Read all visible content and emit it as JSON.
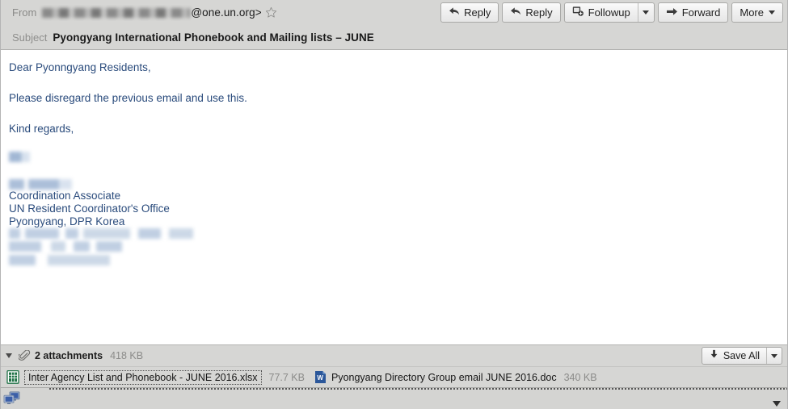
{
  "header": {
    "from_label": "From",
    "from_redacted": true,
    "from_address": "@one.un.org>",
    "star_icon": "star-outline-icon",
    "subject_label": "Subject",
    "subject": "Pyongyang International Phonebook and Mailing lists – JUNE"
  },
  "toolbar": {
    "buttons": [
      {
        "label": "Reply",
        "icon": "reply-arrow-icon",
        "has_dropdown": false
      },
      {
        "label": "Reply",
        "icon": "reply-arrow-icon",
        "has_dropdown": false
      },
      {
        "label": "Followup",
        "icon": "followup-flag-icon",
        "has_dropdown": true
      },
      {
        "label": "Forward",
        "icon": "forward-arrow-icon",
        "has_dropdown": false
      },
      {
        "label": "More",
        "icon": "",
        "has_dropdown": true
      }
    ]
  },
  "body": {
    "greeting": "Dear Pyonngyang Residents,",
    "paragraph": "Please disregard the previous email and use this.",
    "closing": "Kind regards,",
    "signature": {
      "name_line": "",
      "blurred_name": "",
      "title": "Coordination Associate",
      "office": "UN Resident Coordinator's Office",
      "location": "Pyongyang, DPR Korea",
      "contact_line_1": "",
      "contact_line_2": "",
      "contact_line_3": ""
    }
  },
  "attachments": {
    "expander_icon": "triangle-down-icon",
    "paperclip_icon": "paperclip-icon",
    "count_label": "2 attachments",
    "total_size": "418 KB",
    "save_all_label": "Save All",
    "save_all_icon": "download-arrow-icon",
    "items": [
      {
        "name": "Inter Agency List and Phonebook - JUNE 2016.xlsx",
        "size": "77.7 KB",
        "icon": "excel-file-icon",
        "icon_color": "#1e7145",
        "focused": true
      },
      {
        "name": "Pyongyang Directory Group email JUNE 2016.doc",
        "size": "340 KB",
        "icon": "word-file-icon",
        "icon_color": "#2b579a",
        "focused": false
      }
    ]
  },
  "status_bar": {
    "left_icon": "connection-monitors-icon",
    "right_icon": "chevron-down-icon"
  },
  "colors": {
    "chrome": "#d6d6d4",
    "body_text": "#2a4b7c",
    "muted": "#8b8b89",
    "excel_green": "#1e7145",
    "word_blue": "#2b579a"
  }
}
